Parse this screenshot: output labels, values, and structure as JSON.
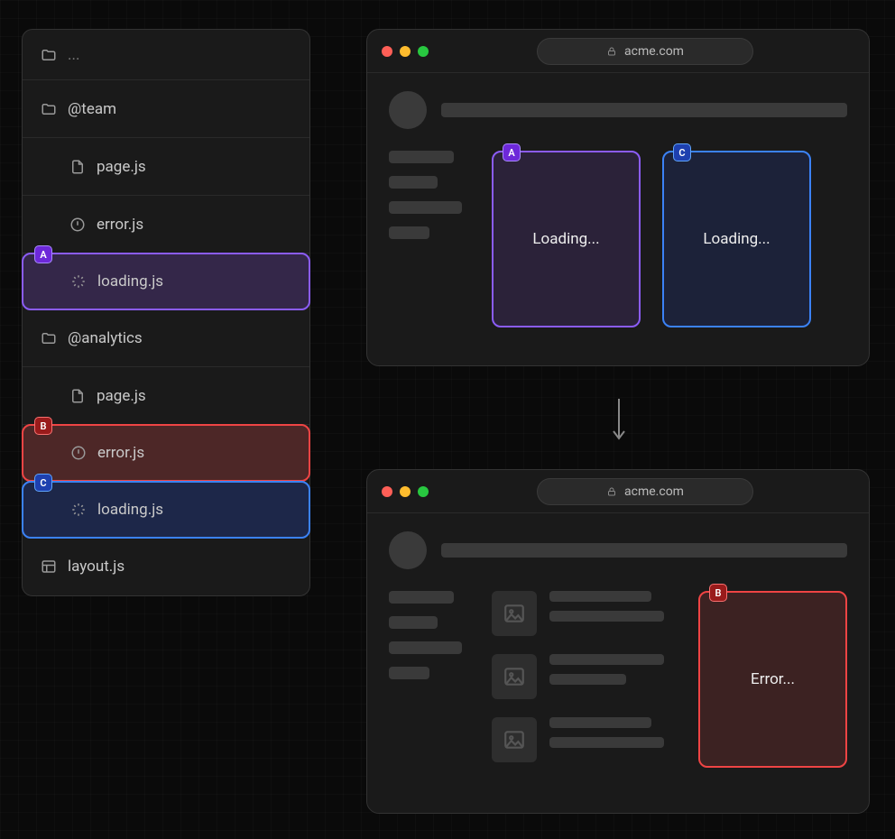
{
  "tree": {
    "header": "...",
    "items": [
      {
        "label": "@team",
        "type": "folder"
      },
      {
        "label": "page.js",
        "type": "file"
      },
      {
        "label": "error.js",
        "type": "error"
      },
      {
        "label": "loading.js",
        "type": "loading",
        "badge": "A",
        "color": "purple"
      },
      {
        "label": "@analytics",
        "type": "folder"
      },
      {
        "label": "page.js",
        "type": "file"
      },
      {
        "label": "error.js",
        "type": "error",
        "badge": "B",
        "color": "red"
      },
      {
        "label": "loading.js",
        "type": "loading",
        "badge": "C",
        "color": "blue"
      },
      {
        "label": "layout.js",
        "type": "layout"
      }
    ]
  },
  "browsers": {
    "top": {
      "url": "acme.com",
      "cards": [
        {
          "badge": "A",
          "color": "purple",
          "text": "Loading..."
        },
        {
          "badge": "C",
          "color": "blue",
          "text": "Loading..."
        }
      ]
    },
    "bottom": {
      "url": "acme.com",
      "card": {
        "badge": "B",
        "color": "red",
        "text": "Error..."
      }
    }
  },
  "badges": {
    "A": "A",
    "B": "B",
    "C": "C"
  }
}
